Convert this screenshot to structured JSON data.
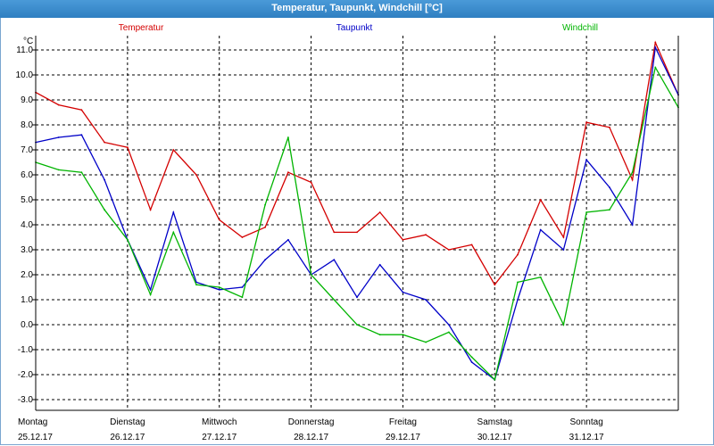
{
  "chart_data": {
    "type": "line",
    "title": "Temperatur, Taupunkt, Windchill [°C]",
    "ylabel": "°C",
    "ylim": [
      -3.0,
      12.0
    ],
    "yticks": [
      -3.0,
      -2.0,
      -1.0,
      0.0,
      1.0,
      2.0,
      3.0,
      4.0,
      5.0,
      6.0,
      7.0,
      8.0,
      9.0,
      10.0,
      11.0
    ],
    "ytick_labels": [
      "-3.0",
      "-2.0",
      "-1.0",
      "0.0",
      "1.0",
      "2.0",
      "3.0",
      "4.0",
      "5.0",
      "6.0",
      "7.0",
      "8.0",
      "9.0",
      "10.0",
      "11.0"
    ],
    "xlim": [
      0,
      7
    ],
    "x_unit": "days from Montag 25.12.17 00:00",
    "xticks": [
      {
        "day": "Montag",
        "date": "25.12.17"
      },
      {
        "day": "Dienstag",
        "date": "26.12.17"
      },
      {
        "day": "Mittwoch",
        "date": "27.12.17"
      },
      {
        "day": "Donnerstag",
        "date": "28.12.17"
      },
      {
        "day": "Freitag",
        "date": "29.12.17"
      },
      {
        "day": "Samstag",
        "date": "30.12.17"
      },
      {
        "day": "Sonntag",
        "date": "31.12.17"
      }
    ],
    "grid": true,
    "legend_position": "top",
    "x": [
      0.0,
      0.25,
      0.5,
      0.75,
      1.0,
      1.25,
      1.5,
      1.75,
      2.0,
      2.25,
      2.5,
      2.75,
      3.0,
      3.25,
      3.5,
      3.75,
      4.0,
      4.25,
      4.5,
      4.75,
      5.0,
      5.25,
      5.5,
      5.75,
      6.0,
      6.25,
      6.5,
      6.75,
      7.0
    ],
    "series": [
      {
        "name": "Temperatur",
        "color": "#d40000",
        "values": [
          9.3,
          8.8,
          8.6,
          7.3,
          7.1,
          4.6,
          7.0,
          6.0,
          4.2,
          3.5,
          3.9,
          6.1,
          5.7,
          3.7,
          3.7,
          4.5,
          3.4,
          3.6,
          3.0,
          3.2,
          1.6,
          2.8,
          5.0,
          3.5,
          8.1,
          7.9,
          5.8,
          11.3,
          9.2
        ]
      },
      {
        "name": "Taupunkt",
        "color": "#0000c8",
        "values": [
          7.3,
          7.5,
          7.6,
          5.8,
          3.4,
          1.4,
          4.5,
          1.7,
          1.4,
          1.5,
          2.6,
          3.4,
          2.0,
          2.6,
          1.1,
          2.4,
          1.3,
          1.0,
          0.0,
          -1.5,
          -2.2,
          1.0,
          3.8,
          3.0,
          6.6,
          5.5,
          4.0,
          11.1,
          9.2
        ]
      },
      {
        "name": "Windchill",
        "color": "#00b400",
        "values": [
          6.5,
          6.2,
          6.1,
          4.6,
          3.4,
          1.2,
          3.7,
          1.6,
          1.5,
          1.1,
          4.8,
          7.5,
          2.0,
          1.0,
          0.0,
          -0.4,
          -0.4,
          -0.7,
          -0.3,
          -1.3,
          -2.2,
          1.7,
          1.9,
          0.0,
          4.5,
          4.6,
          6.1,
          10.3,
          8.7
        ]
      }
    ]
  }
}
